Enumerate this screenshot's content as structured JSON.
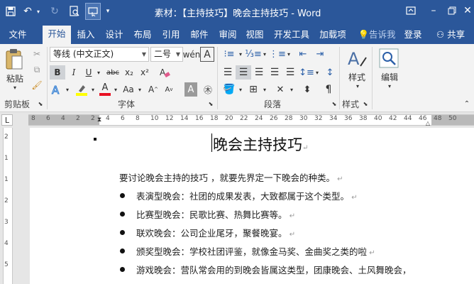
{
  "window": {
    "title": "素材：【主持技巧】晚会主持技巧 - Word"
  },
  "ribbon_tabs": [
    {
      "label": "文件"
    },
    {
      "label": "开始"
    },
    {
      "label": "插入"
    },
    {
      "label": "设计"
    },
    {
      "label": "布局"
    },
    {
      "label": "引用"
    },
    {
      "label": "邮件"
    },
    {
      "label": "审阅"
    },
    {
      "label": "视图"
    },
    {
      "label": "开发工具"
    },
    {
      "label": "加载项"
    }
  ],
  "tell_me": "告诉我",
  "login": "登录",
  "share": "共享",
  "font": {
    "name": "等线 (中文正文)",
    "size": "二号"
  },
  "group_labels": {
    "clipboard": "剪贴板",
    "font": "字体",
    "paragraph": "段落",
    "styles": "样式"
  },
  "buttons": {
    "paste": "粘贴",
    "styles": "样式",
    "editing": "编辑",
    "bold": "B",
    "italic": "I",
    "underline": "U",
    "strikethrough": "abc",
    "subscript": "x₂",
    "superscript": "x²",
    "font_color": "A",
    "change_case": "Aa"
  },
  "ruler": {
    "h_numbers": [
      "8",
      "6",
      "4",
      "2",
      "2",
      "4",
      "6",
      "8",
      "10",
      "12",
      "14",
      "16",
      "18",
      "20",
      "22",
      "24",
      "26",
      "28",
      "30",
      "32",
      "34",
      "36",
      "38",
      "40",
      "42",
      "44",
      "46",
      "48",
      "50"
    ],
    "v_numbers": [
      "2",
      "1",
      "1",
      "2",
      "3",
      "4",
      "5"
    ]
  },
  "document": {
    "title": "晚会主持技巧",
    "intro": "要讨论晚会主持的技巧 ，就要先界定一下晚会的种类。",
    "bullets": [
      "表演型晚会：社团的成果发表，大致都属于这个类型。",
      "比赛型晚会：民歌比赛、热舞比赛等。",
      "联欢晚会：公司企业尾牙，聚餐晚宴。",
      "颁奖型晚会：学校社团评鉴，就像金马奖、金曲奖之类的啦",
      "游戏晚会：营队常会用的到晚会皆属这类型，团康晚会、土风舞晚会，"
    ]
  },
  "colors": {
    "accent": "#2b579a",
    "highlight": "#ffff00",
    "font_color": "#e81123"
  }
}
